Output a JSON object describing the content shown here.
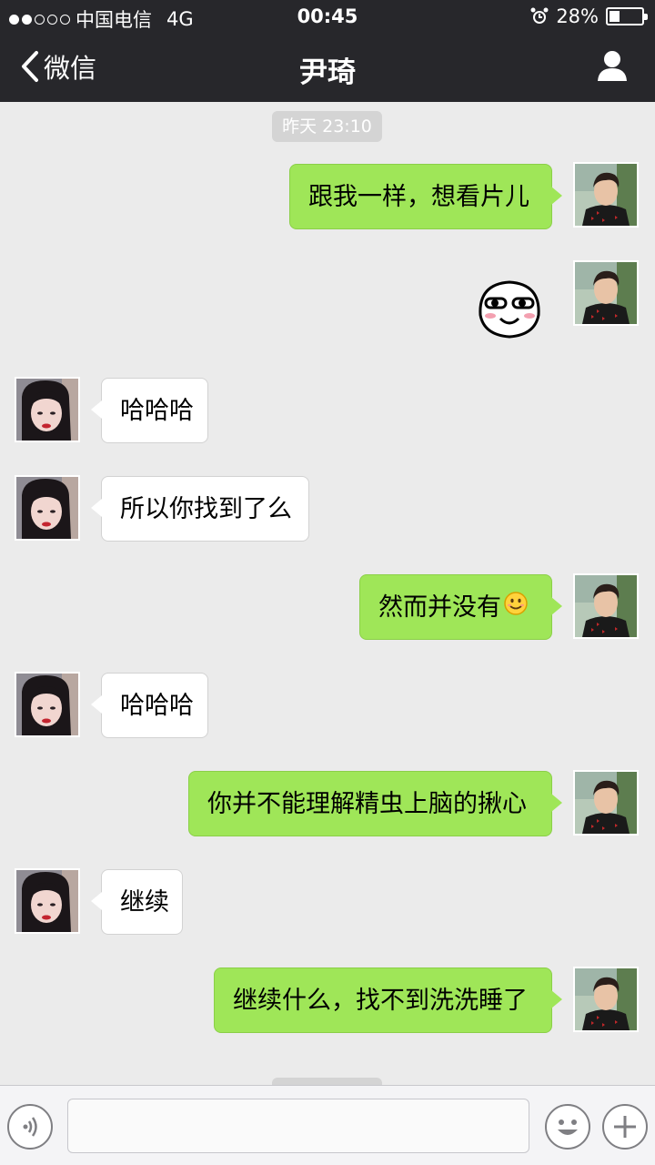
{
  "status_bar": {
    "carrier": "中国电信",
    "network": "4G",
    "time": "00:45",
    "battery_percent": "28%",
    "battery_level": 0.28,
    "signal_strength": 2,
    "signal_total": 5,
    "alarm_icon": "alarm-clock-icon"
  },
  "nav": {
    "back_label": "微信",
    "title": "尹琦",
    "profile_icon": "person-icon"
  },
  "chat": {
    "timestamp": "昨天 23:10",
    "messages": [
      {
        "side": "me",
        "type": "text",
        "text": "跟我一样，想看片儿"
      },
      {
        "side": "me",
        "type": "sticker",
        "sticker": "smug-face-sticker"
      },
      {
        "side": "them",
        "type": "text",
        "text": "哈哈哈"
      },
      {
        "side": "them",
        "type": "text",
        "text": "所以你找到了么"
      },
      {
        "side": "me",
        "type": "text",
        "text": "然而并没有",
        "emoji": "smile-emoji"
      },
      {
        "side": "them",
        "type": "text",
        "text": "哈哈哈"
      },
      {
        "side": "me",
        "type": "text",
        "text": "你并不能理解精虫上脑的揪心"
      },
      {
        "side": "them",
        "type": "text",
        "text": "继续"
      },
      {
        "side": "me",
        "type": "text",
        "text": "继续什么，找不到洗洗睡了"
      }
    ]
  },
  "input_bar": {
    "voice_icon": "voice-icon",
    "input_value": "",
    "emoji_icon": "emoji-face-icon",
    "plus_icon": "plus-icon"
  },
  "colors": {
    "nav_bg": "#27272b",
    "chat_bg": "#ebebeb",
    "my_bubble": "#9fe658",
    "their_bubble": "#ffffff"
  }
}
